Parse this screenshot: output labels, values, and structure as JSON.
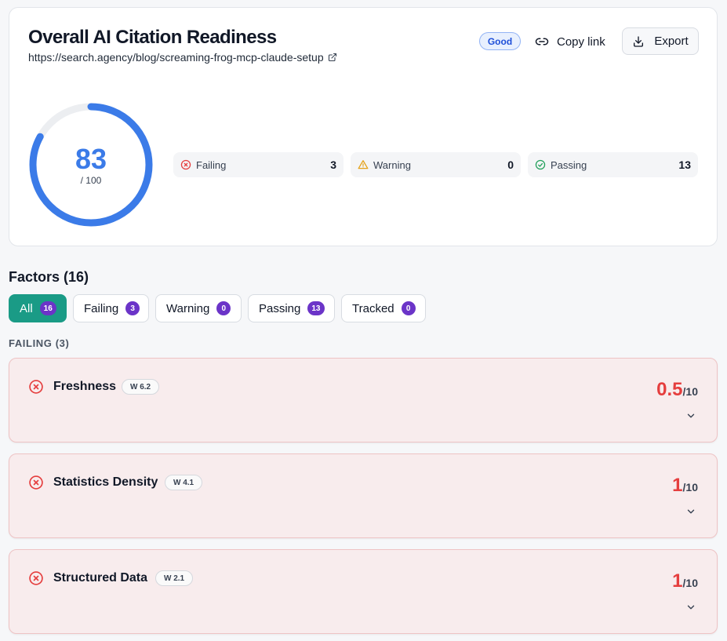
{
  "header": {
    "title": "Overall AI Citation Readiness",
    "url": "https://search.agency/blog/screaming-frog-mcp-claude-setup",
    "badge": "Good",
    "copy_link": "Copy link",
    "export": "Export"
  },
  "score": {
    "value": "83",
    "max": "/ 100",
    "fraction": 0.83,
    "color": "#3b7be8"
  },
  "stats": [
    {
      "label": "Failing",
      "count": "3",
      "icon": "x-circle-icon",
      "color": "#e53e3e"
    },
    {
      "label": "Warning",
      "count": "0",
      "icon": "warning-triangle-icon",
      "color": "#e5a21a"
    },
    {
      "label": "Passing",
      "count": "13",
      "icon": "check-circle-icon",
      "color": "#22a05b"
    }
  ],
  "factors": {
    "title": "Factors (16)",
    "filters": [
      {
        "label": "All",
        "count": "16"
      },
      {
        "label": "Failing",
        "count": "3"
      },
      {
        "label": "Warning",
        "count": "0"
      },
      {
        "label": "Passing",
        "count": "13"
      },
      {
        "label": "Tracked",
        "count": "0"
      }
    ],
    "section_label": "FAILING (3)",
    "items": [
      {
        "name": "Freshness",
        "weight": "W 6.2",
        "score": "0.5",
        "max": "/10"
      },
      {
        "name": "Statistics Density",
        "weight": "W 4.1",
        "score": "1",
        "max": "/10"
      },
      {
        "name": "Structured Data",
        "weight": "W 2.1",
        "score": "1",
        "max": "/10"
      }
    ]
  },
  "colors": {
    "accent": "#1a9b86",
    "count_badge": "#6b34c8",
    "fail": "#e53e3e"
  }
}
